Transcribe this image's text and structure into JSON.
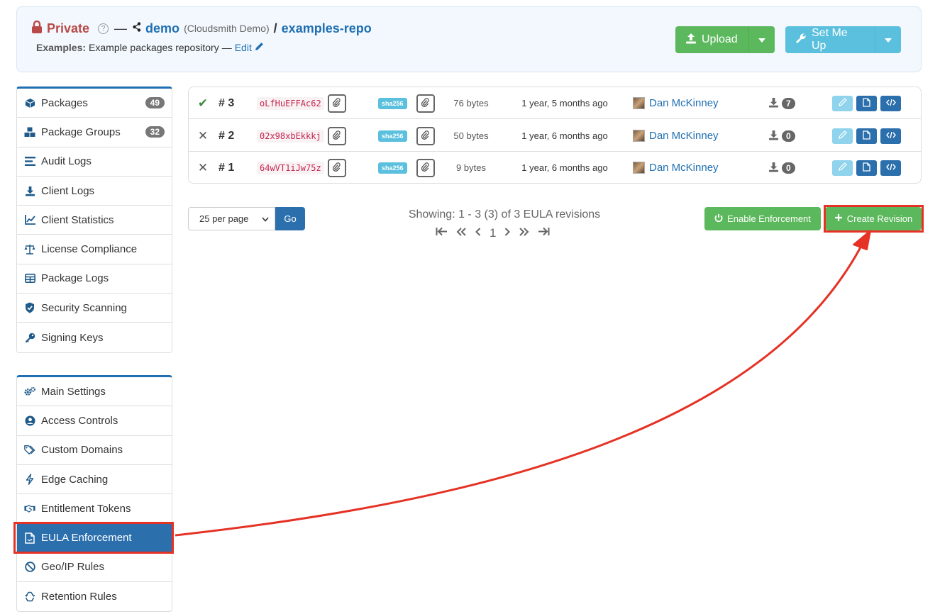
{
  "header": {
    "visibility": "Private",
    "separator": "—",
    "org_name": "demo",
    "org_full": "(Cloudsmith Demo)",
    "slash": "/",
    "repo_name": "examples-repo",
    "desc_label": "Examples:",
    "desc_text": "Example packages repository",
    "desc_sep": "—",
    "edit_label": "Edit",
    "upload_label": "Upload",
    "setme_label": "Set Me Up"
  },
  "sidebar": {
    "group1": [
      {
        "label": "Packages",
        "badge": "49",
        "icon": "box-icon"
      },
      {
        "label": "Package Groups",
        "badge": "32",
        "icon": "boxes-icon"
      },
      {
        "label": "Audit Logs",
        "icon": "list-icon"
      },
      {
        "label": "Client Logs",
        "icon": "download-icon"
      },
      {
        "label": "Client Statistics",
        "icon": "chart-icon"
      },
      {
        "label": "License Compliance",
        "icon": "scale-icon"
      },
      {
        "label": "Package Logs",
        "icon": "table-icon"
      },
      {
        "label": "Security Scanning",
        "icon": "shield-icon"
      },
      {
        "label": "Signing Keys",
        "icon": "key-icon"
      }
    ],
    "group2": [
      {
        "label": "Main Settings",
        "icon": "gears-icon"
      },
      {
        "label": "Access Controls",
        "icon": "user-circle-icon"
      },
      {
        "label": "Custom Domains",
        "icon": "tags-icon"
      },
      {
        "label": "Edge Caching",
        "icon": "bolt-icon"
      },
      {
        "label": "Entitlement Tokens",
        "icon": "handshake-icon"
      },
      {
        "label": "EULA Enforcement",
        "icon": "file-contract-icon"
      },
      {
        "label": "Geo/IP Rules",
        "icon": "ban-icon"
      },
      {
        "label": "Retention Rules",
        "icon": "recycle-icon"
      }
    ]
  },
  "revisions": [
    {
      "status": "✔",
      "number": "# 3",
      "hash": "oLfHuEFFAc62",
      "sha_label": "sha256",
      "size": "76 bytes",
      "time": "1 year, 5 months ago",
      "user": "Dan McKinney",
      "downloads": "7"
    },
    {
      "status": "✕",
      "number": "# 2",
      "hash": "02x98xbEkkkj",
      "sha_label": "sha256",
      "size": "50 bytes",
      "time": "1 year, 6 months ago",
      "user": "Dan McKinney",
      "downloads": "0"
    },
    {
      "status": "✕",
      "number": "# 1",
      "hash": "64wVT1iJw75z",
      "sha_label": "sha256",
      "size": "9 bytes",
      "time": "1 year, 6 months ago",
      "user": "Dan McKinney",
      "downloads": "0"
    }
  ],
  "pagination": {
    "per_page": "25 per page",
    "go_label": "Go",
    "showing": "Showing: 1 - 3 (3) of 3 EULA revisions",
    "page": "1"
  },
  "actions": {
    "enable_label": "Enable Enforcement",
    "create_label": "Create Revision"
  },
  "colors": {
    "primary": "#2b6fad",
    "success": "#5cb85c",
    "info": "#5bc0de",
    "danger": "#b94a48",
    "annotation": "#e53225"
  }
}
